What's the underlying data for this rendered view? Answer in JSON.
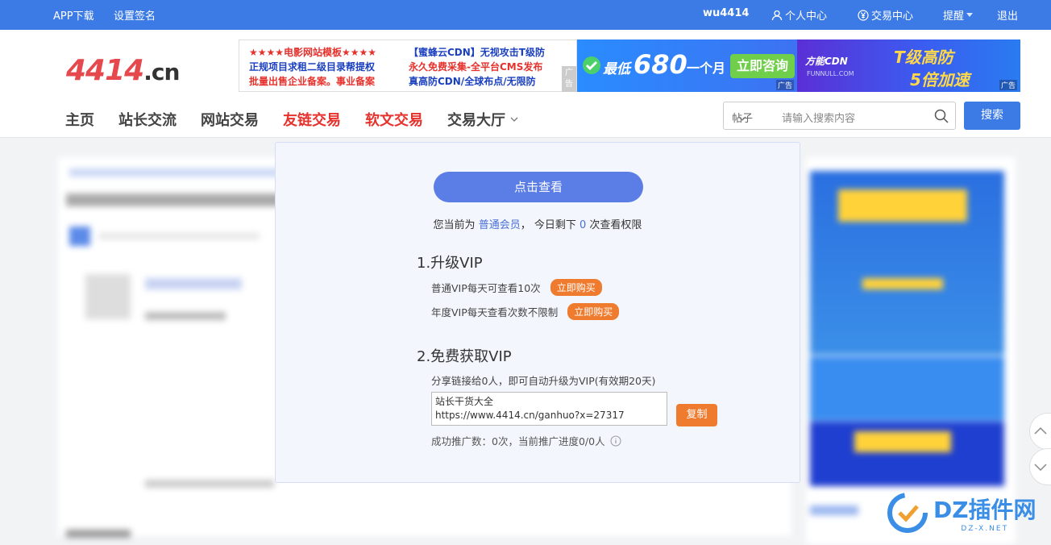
{
  "topbar": {
    "app_download": "APP下载",
    "set_signature": "设置签名",
    "username": "wu4414",
    "personal_center": "个人中心",
    "trade_center": "交易中心",
    "remind": "提醒",
    "logout": "退出"
  },
  "logo": {
    "num": "4414",
    "domain": ".cn"
  },
  "text_ad": {
    "col1": [
      "★★★★电影网站模板★★★★",
      "正规项目求租二级目录帮提权",
      "批量出售企业备案。事业备案"
    ],
    "col2": [
      "【蜜蜂云CDN】无视攻击T级防",
      "永久免费采集-全平台CMS发布",
      "真高防CDN/全球布点/无限防"
    ],
    "tag": "广告"
  },
  "banner_ad_1": {
    "prefix": "最低",
    "price": "680",
    "unit": "一个月",
    "cta": "立即咨询",
    "tag": "广告"
  },
  "banner_ad_2": {
    "brand": "方能CDN",
    "site": "FUNNULL.COM",
    "line1": "T级高防",
    "line2": "5倍加速",
    "tag": "广告"
  },
  "nav": {
    "items": [
      {
        "label": "主页",
        "highlight": false
      },
      {
        "label": "站长交流",
        "highlight": false
      },
      {
        "label": "网站交易",
        "highlight": false
      },
      {
        "label": "友链交易",
        "highlight": true
      },
      {
        "label": "软文交易",
        "highlight": true
      },
      {
        "label": "交易大厅",
        "highlight": false
      }
    ]
  },
  "search": {
    "type": "帖子",
    "placeholder": "请输入搜索内容",
    "button": "搜索"
  },
  "modal": {
    "view_button": "点击查看",
    "member_prefix": "您当前为",
    "member_level": "普通会员",
    "member_mid": "， 今日剩下",
    "remaining": "0",
    "member_suffix": "次查看权限",
    "upgrade_title": "1.升级VIP",
    "vip_normal": "普通VIP每天可查看10次",
    "vip_year": "年度VIP每天查看次数不限制",
    "buy_label": "立即购买",
    "free_title": "2.免费获取VIP",
    "share_desc": "分享链接给0人，即可自动升级为VIP(有效期20天)",
    "share_text_line1": "站长干货大全",
    "share_text_line2": "https://www.4414.cn/ganhuo?x=27317",
    "copy_label": "复制",
    "stats": "成功推广数：0次，当前推广进度0/0人"
  },
  "watermark": {
    "text": "DZ插件网",
    "sub": "DZ-X.NET"
  },
  "colors": {
    "primary": "#3c7be5",
    "accent_red": "#e5322d",
    "orange": "#ef7b2f",
    "modal_button": "#5b7de6"
  }
}
